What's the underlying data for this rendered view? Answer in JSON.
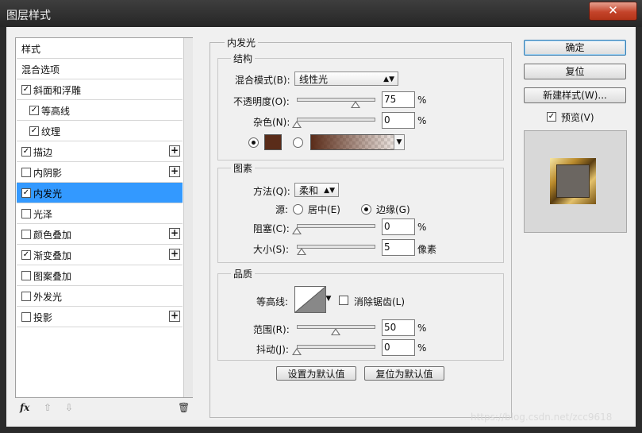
{
  "window": {
    "title": "图层样式",
    "close_symbol": "✕"
  },
  "sidebar": {
    "items": [
      {
        "label": "样式",
        "checkbox": false,
        "checked": false,
        "plus": false,
        "indent": false,
        "selected": false
      },
      {
        "label": "混合选项",
        "checkbox": false,
        "checked": false,
        "plus": false,
        "indent": false,
        "selected": false
      },
      {
        "label": "斜面和浮雕",
        "checkbox": true,
        "checked": true,
        "plus": false,
        "indent": false,
        "selected": false
      },
      {
        "label": "等高线",
        "checkbox": true,
        "checked": true,
        "plus": false,
        "indent": true,
        "selected": false
      },
      {
        "label": "纹理",
        "checkbox": true,
        "checked": true,
        "plus": false,
        "indent": true,
        "selected": false
      },
      {
        "label": "描边",
        "checkbox": true,
        "checked": true,
        "plus": true,
        "indent": false,
        "selected": false
      },
      {
        "label": "内阴影",
        "checkbox": true,
        "checked": false,
        "plus": true,
        "indent": false,
        "selected": false
      },
      {
        "label": "内发光",
        "checkbox": true,
        "checked": true,
        "plus": false,
        "indent": false,
        "selected": true
      },
      {
        "label": "光泽",
        "checkbox": true,
        "checked": false,
        "plus": false,
        "indent": false,
        "selected": false
      },
      {
        "label": "颜色叠加",
        "checkbox": true,
        "checked": false,
        "plus": true,
        "indent": false,
        "selected": false
      },
      {
        "label": "渐变叠加",
        "checkbox": true,
        "checked": true,
        "plus": true,
        "indent": false,
        "selected": false
      },
      {
        "label": "图案叠加",
        "checkbox": true,
        "checked": false,
        "plus": false,
        "indent": false,
        "selected": false
      },
      {
        "label": "外发光",
        "checkbox": true,
        "checked": false,
        "plus": false,
        "indent": false,
        "selected": false
      },
      {
        "label": "投影",
        "checkbox": true,
        "checked": false,
        "plus": true,
        "indent": false,
        "selected": false
      }
    ],
    "bottom": {
      "fx": "fx",
      "up": "⇧",
      "down": "⇩",
      "trash": "🗑"
    }
  },
  "main": {
    "section_title": "内发光",
    "structure": {
      "title": "结构",
      "blend_mode_label": "混合模式(B):",
      "blend_mode_value": "线性光",
      "opacity_label": "不透明度(O):",
      "opacity_value": "75",
      "noise_label": "杂色(N):",
      "noise_value": "0",
      "percent": "%",
      "color_hex": "#5a2c19"
    },
    "elements": {
      "title": "图素",
      "technique_label": "方法(Q):",
      "technique_value": "柔和",
      "source_label": "源:",
      "center_label": "居中(E)",
      "edge_label": "边缘(G)",
      "choke_label": "阻塞(C):",
      "choke_value": "0",
      "size_label": "大小(S):",
      "size_value": "5",
      "size_unit": "像素"
    },
    "quality": {
      "title": "品质",
      "contour_label": "等高线:",
      "antialias_label": "消除锯齿(L)",
      "range_label": "范围(R):",
      "range_value": "50",
      "jitter_label": "抖动(J):",
      "jitter_value": "0"
    },
    "set_default": "设置为默认值",
    "reset_default": "复位为默认值"
  },
  "right": {
    "ok": "确定",
    "reset": "复位",
    "new_style": "新建样式(W)...",
    "preview_label": "预览(V)",
    "preview_checked": true
  },
  "watermark": "https://blog.csdn.net/zcc9618"
}
